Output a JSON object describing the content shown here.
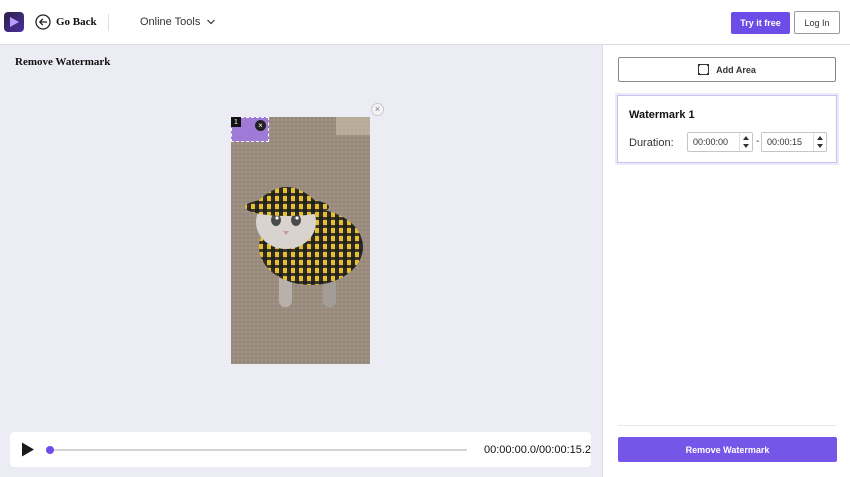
{
  "header": {
    "go_back_label": "Go Back",
    "online_tools_label": "Online Tools",
    "try_label": "Try it free",
    "login_label": "Log In"
  },
  "editor": {
    "title": "Remove Watermark",
    "watermark_index": "1",
    "close_glyph": "×"
  },
  "player": {
    "time_display": "00:00:00.0/00:00:15.2",
    "progress_fraction": 0.0
  },
  "panel": {
    "add_area_label": "Add Area",
    "card_title": "Watermark 1",
    "duration_label": "Duration:",
    "start_time": "00:00:00",
    "end_time": "00:00:15",
    "separator": "-",
    "remove_label": "Remove Watermark"
  },
  "colors": {
    "accent": "#6d4ce8",
    "editor_bg": "#ebecf4"
  }
}
